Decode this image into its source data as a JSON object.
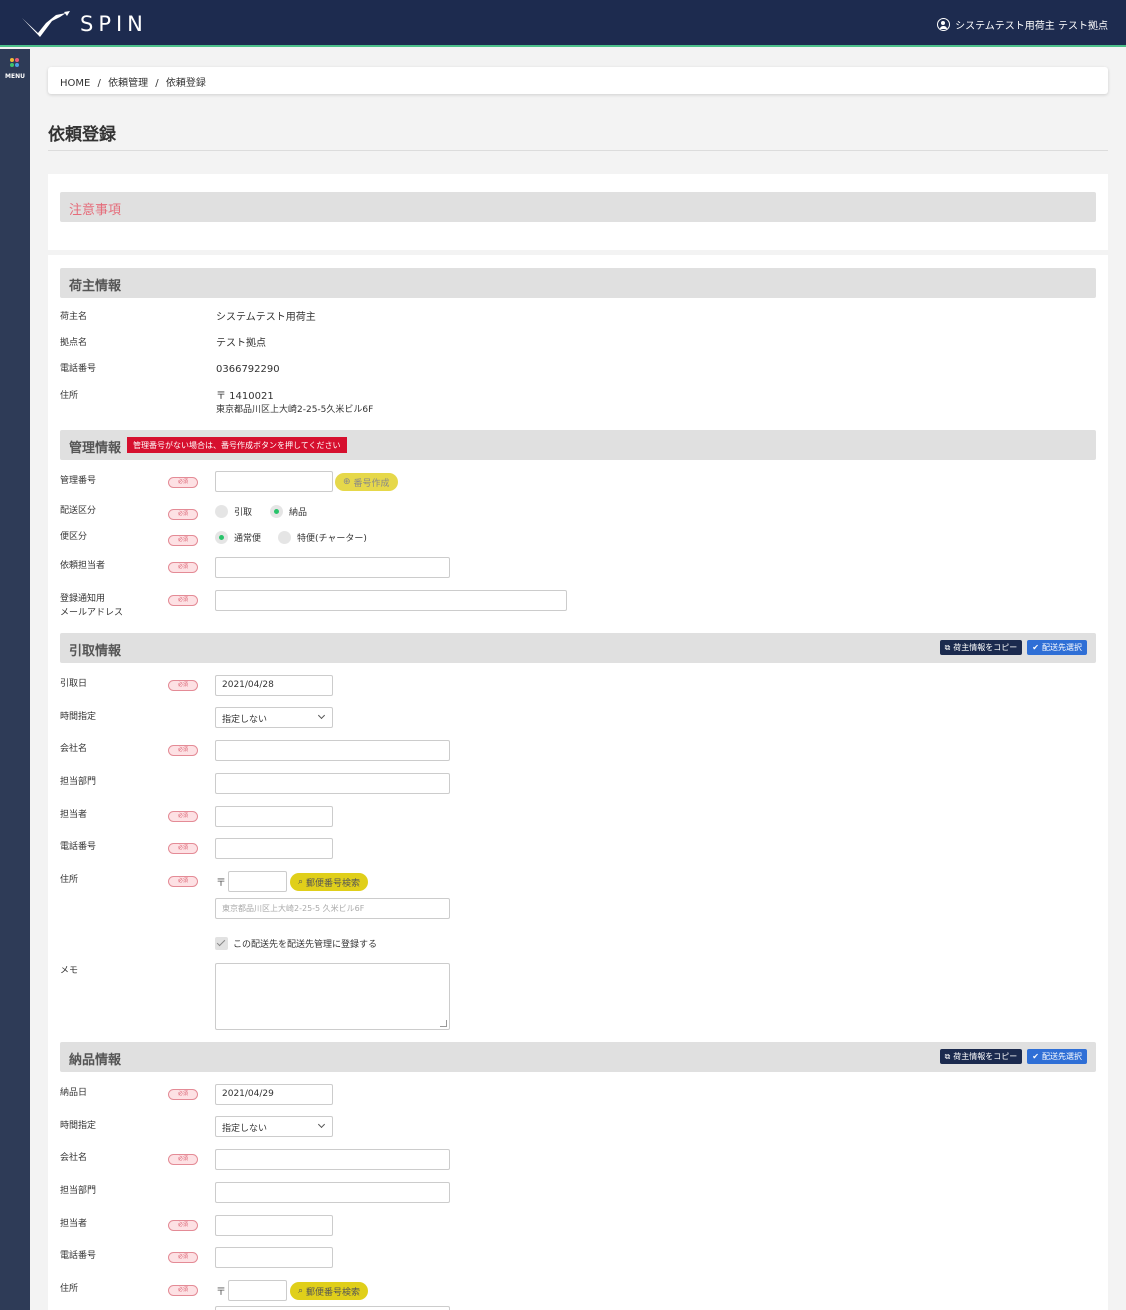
{
  "header": {
    "logo_text": "SPIN",
    "user": "システムテスト用荷主 テスト拠点"
  },
  "sidebar": {
    "menu_label": "MENU"
  },
  "breadcrumb": [
    "HOME",
    "/",
    "依頼管理",
    "/",
    "依頼登録"
  ],
  "page_title": "依頼登録",
  "notice": {
    "title": "注意事項"
  },
  "shipper": {
    "title": "荷主情報",
    "name_label": "荷主名",
    "name_value": "システムテスト用荷主",
    "base_label": "拠点名",
    "base_value": "テスト拠点",
    "tel_label": "電話番号",
    "tel_value": "0366792290",
    "addr_label": "住所",
    "zip_value": "〒 1410021",
    "addr_value": "東京都品川区上大崎2-25-5久米ビル6F"
  },
  "management": {
    "title": "管理情報",
    "note": "管理番号がない場合は、番号作成ボタンを押してください",
    "required": "必須",
    "number_label": "管理番号",
    "number_value": "",
    "generate_button": "番号作成",
    "delivery_type_label": "配送区分",
    "delivery_type_options": [
      "引取",
      "納品"
    ],
    "delivery_type_selected": "納品",
    "service_label": "便区分",
    "service_options": [
      "通常便",
      "特便(チャーター)"
    ],
    "service_selected": "通常便",
    "requester_label": "依頼担当者",
    "requester_value": "",
    "email_label_1": "登録通知用",
    "email_label_2": "メールアドレス",
    "email_value": ""
  },
  "pickup": {
    "title": "引取情報",
    "copy_button": "荷主情報をコピー",
    "select_button": "配送先選択",
    "date_label": "引取日",
    "date_value": "2021/04/28",
    "time_label": "時間指定",
    "time_value": "指定しない",
    "company_label": "会社名",
    "company_value": "",
    "dept_label": "担当部門",
    "dept_value": "",
    "person_label": "担当者",
    "person_value": "",
    "tel_label": "電話番号",
    "tel_value": "",
    "addr_label": "住所",
    "zip_mark": "〒",
    "zip_value": "",
    "zip_search_button": "郵便番号検索",
    "addr_placeholder": "東京都品川区上大崎2-25-5 久米ビル6F",
    "register_checkbox": "この配送先を配送先管理に登録する",
    "memo_label": "メモ"
  },
  "delivery": {
    "title": "納品情報",
    "copy_button": "荷主情報をコピー",
    "select_button": "配送先選択",
    "date_label": "納品日",
    "date_value": "2021/04/29",
    "time_label": "時間指定",
    "time_value": "指定しない",
    "company_label": "会社名",
    "company_value": "",
    "dept_label": "担当部門",
    "dept_value": "",
    "person_label": "担当者",
    "person_value": "",
    "tel_label": "電話番号",
    "tel_value": "",
    "addr_label": "住所",
    "zip_mark": "〒",
    "zip_value": "",
    "zip_search_button": "郵便番号検索"
  },
  "colors": {
    "header_bg": "#1d2b4f",
    "accent_green": "#4cc08a",
    "required_pink": "#fde1e4",
    "button_yellow": "#e0cf1a",
    "copy_navy": "#1b2a4e",
    "select_blue": "#2f6fd6",
    "note_red": "#d60f2e"
  }
}
